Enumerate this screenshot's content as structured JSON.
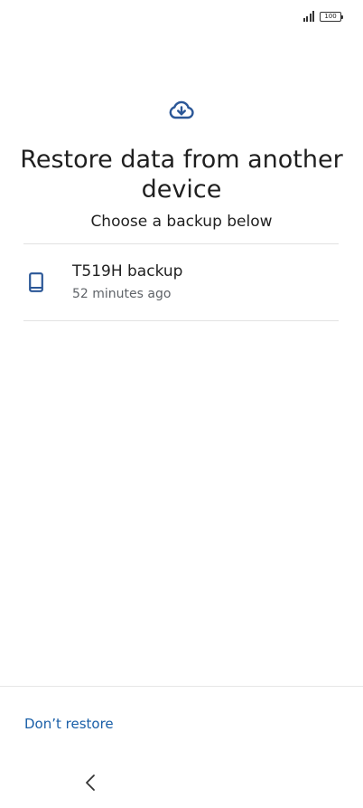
{
  "status_bar": {
    "battery_level": "100",
    "signal_icon": "signal-bars-icon",
    "battery_icon": "battery-icon"
  },
  "header": {
    "icon": "cloud-download-icon",
    "title": "Restore data from another device",
    "subtitle": "Choose a backup below"
  },
  "backups": [
    {
      "icon": "phone-icon",
      "name": "T519H backup",
      "time": "52 minutes ago"
    }
  ],
  "footer": {
    "dont_restore_label": "Don’t restore"
  },
  "navigation": {
    "back_icon": "chevron-left-icon"
  },
  "colors": {
    "accent": "#1a5fa8",
    "icon_primary": "#2b5797",
    "text_primary": "#1f1f1f",
    "text_secondary": "#5f6368"
  }
}
